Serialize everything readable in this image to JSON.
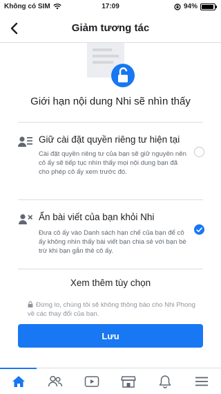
{
  "status_bar": {
    "carrier": "Không có SIM",
    "time": "17:09",
    "battery_text": "94%",
    "battery_level": 0.94
  },
  "nav": {
    "title": "Giảm tương tác"
  },
  "header": {
    "headline": "Giới hạn nội dung Nhi sẽ nhìn thấy"
  },
  "options": [
    {
      "title": "Giữ cài đặt quyền riêng tư hiện tại",
      "desc": "Cài đặt quyền riêng tư của bạn sẽ giữ nguyên nên cô ấy sẽ tiếp tục nhìn thấy mọi nội dung bạn đã cho phép cô ấy xem trước đó.",
      "selected": false
    },
    {
      "title": "Ẩn bài viết của bạn khỏi Nhi",
      "desc": "Đưa cô ấy vào Danh sách hạn chế của bạn để cô ấy không nhìn thấy bài viết bạn chia sẻ với bạn bè trừ khi bạn gắn thẻ cô ấy.",
      "selected": true
    }
  ],
  "more_options_label": "Xem thêm tùy chọn",
  "notice": "Đừng lo, chúng tôi sẽ không thông báo cho Nhi Phong về các thay đổi của bạn.",
  "save_label": "Lưu",
  "tabs": [
    "home-icon",
    "friends-icon",
    "watch-icon",
    "marketplace-icon",
    "notifications-icon",
    "menu-icon"
  ],
  "colors": {
    "accent": "#1877f2",
    "text_primary": "#1c1e21",
    "text_secondary": "#606770",
    "divider": "#dadde1"
  }
}
